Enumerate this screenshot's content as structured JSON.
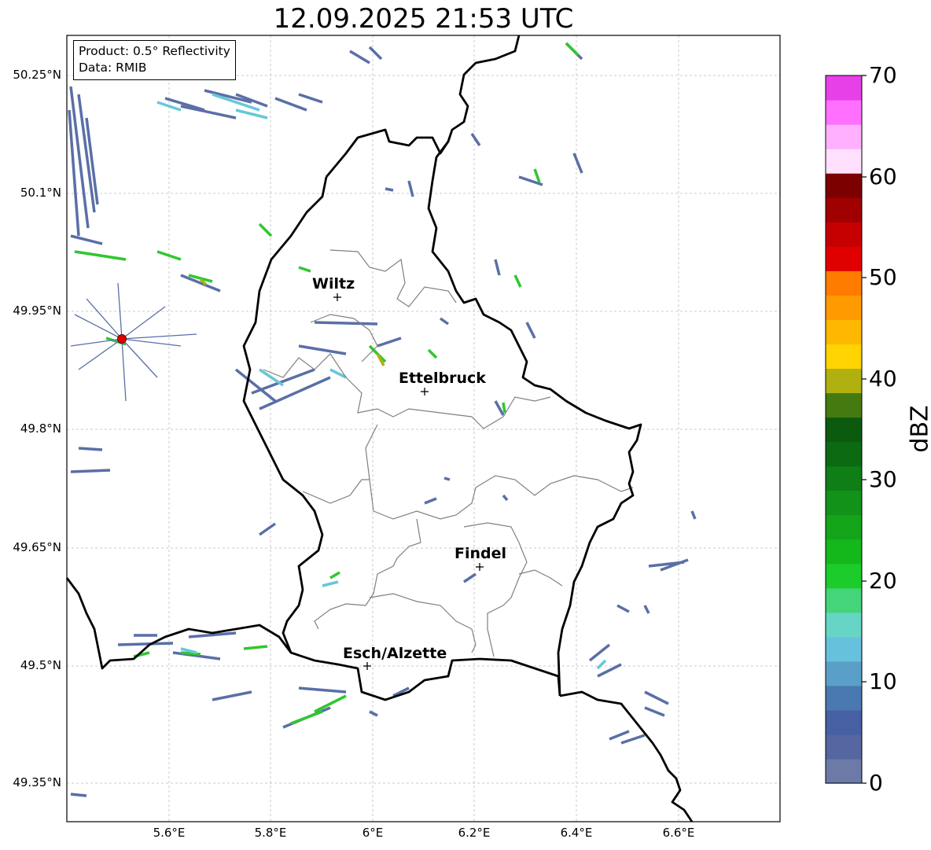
{
  "title": "12.09.2025 21:53 UTC",
  "info": {
    "product": "Product: 0.5° Reflectivity",
    "data": "Data: RMIB"
  },
  "lat_labels": [
    "50.25°N",
    "50.1°N",
    "49.95°N",
    "49.8°N",
    "49.65°N",
    "49.5°N",
    "49.35°N"
  ],
  "lon_labels": [
    "5.6°E",
    "5.8°E",
    "6°E",
    "6.2°E",
    "6.4°E",
    "6.6°E"
  ],
  "cities": [
    {
      "name": "Wiltz"
    },
    {
      "name": "Ettelbruck"
    },
    {
      "name": "Findel"
    },
    {
      "name": "Esch/Alzette"
    }
  ],
  "colorbar": {
    "label": "dBZ",
    "ticks": [
      "70",
      "60",
      "50",
      "40",
      "30",
      "20",
      "10",
      "0"
    ],
    "range": [
      0,
      70
    ],
    "colors": [
      "#6c7aa8",
      "#5566a0",
      "#4660a3",
      "#4a78b0",
      "#5a9fc8",
      "#66c1dc",
      "#66d5c6",
      "#44d47a",
      "#1ccc2a",
      "#14b81a",
      "#14a41a",
      "#13921a",
      "#0f7e16",
      "#0b6a12",
      "#0b5a10",
      "#447a10",
      "#b0b010",
      "#ffd400",
      "#ffb800",
      "#ff9b00",
      "#ff7c00",
      "#e00000",
      "#c60000",
      "#a00000",
      "#7c0000",
      "#ffe0ff",
      "#ffb0ff",
      "#ff70ff",
      "#e840e8"
    ]
  },
  "radar_site_color": "#e00000"
}
